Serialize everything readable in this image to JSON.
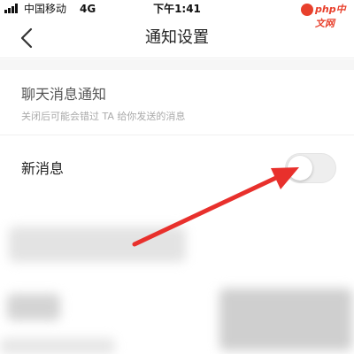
{
  "status_bar": {
    "carrier": "中国移动",
    "network": "4G",
    "time": "下午1:41",
    "watermark_text": "php中文网"
  },
  "header": {
    "title": "通知设置",
    "back_icon": "chevron-left-icon"
  },
  "chat_notifications": {
    "title": "聊天消息通知",
    "description": "关闭后可能会错过 TA 给你发送的消息"
  },
  "new_message": {
    "label": "新消息",
    "toggle_on": false
  },
  "annotation": {
    "arrow_color": "#e8302c"
  },
  "colors": {
    "accent": "#e8302c",
    "toggle_off": "#eeeeee"
  }
}
